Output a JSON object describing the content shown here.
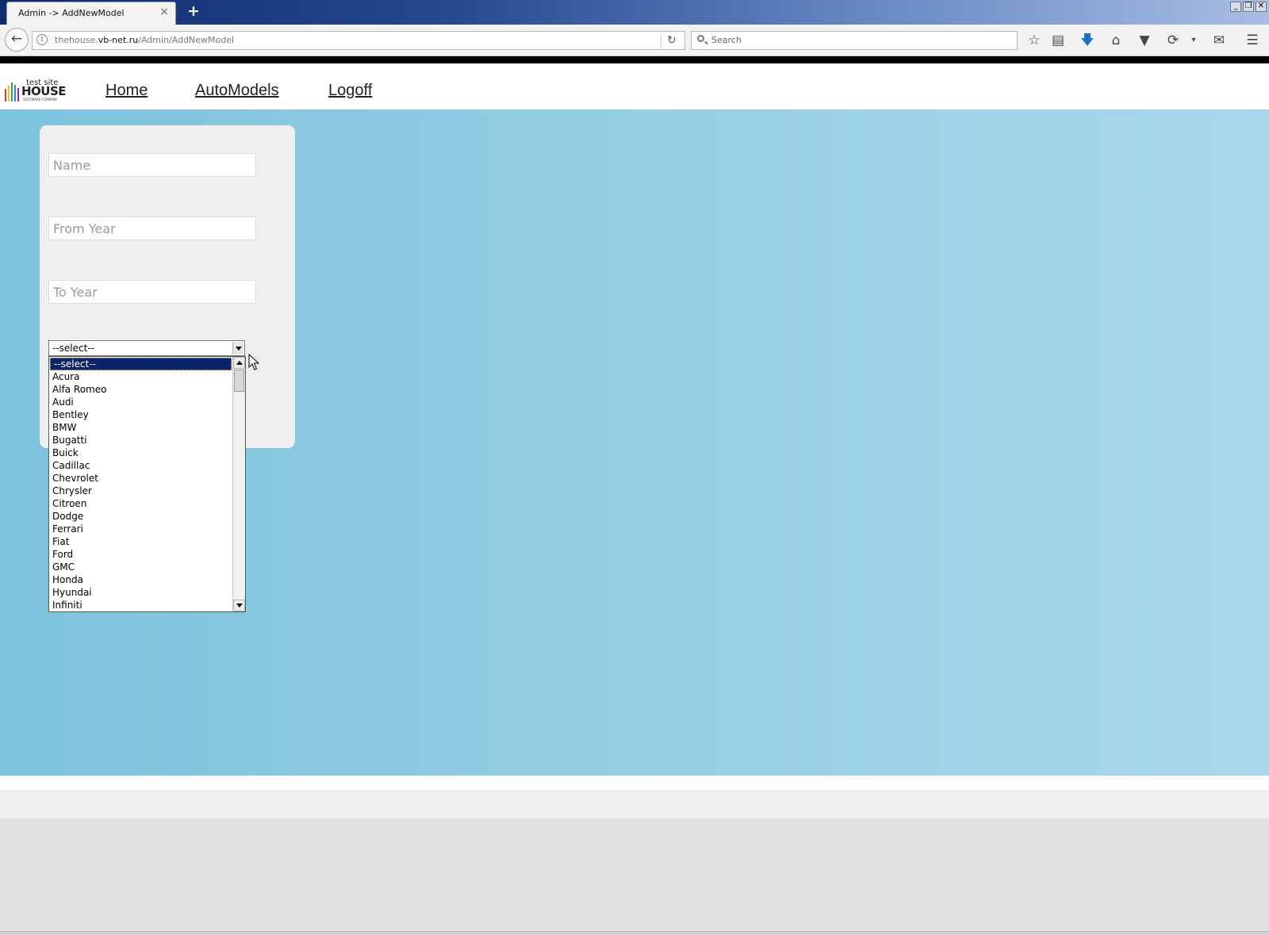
{
  "browser": {
    "tab_title": "Admin -> AddNewModel",
    "tab_close": "×",
    "new_tab": "+",
    "url_domain_prefix": "thehouse.",
    "url_domain_main": "vb-net.ru",
    "url_path": "/Admin/AddNewModel",
    "search_placeholder": "Search",
    "window_buttons": [
      "_",
      "❐",
      "✕"
    ]
  },
  "site": {
    "logo": {
      "small_text": "test site",
      "big_text": "HOUSE",
      "tagline": "SOFTWARE COMPANY",
      "bar_colors": [
        "#e53935",
        "#fbc02d",
        "#43a047",
        "#1e88e5",
        "#8e24aa",
        "#f4511e"
      ]
    },
    "nav": [
      {
        "label": "Home"
      },
      {
        "label": "AutoModels"
      },
      {
        "label": "Logoff"
      }
    ]
  },
  "form": {
    "name_placeholder": "Name",
    "from_year_placeholder": "From Year",
    "to_year_placeholder": "To Year",
    "select_value": "--select--",
    "options": [
      "--select--",
      "Acura",
      "Alfa Romeo",
      "Audi",
      "Bentley",
      "BMW",
      "Bugatti",
      "Buick",
      "Cadillac",
      "Chevrolet",
      "Chrysler",
      "Citroen",
      "Dodge",
      "Ferrari",
      "Fiat",
      "Ford",
      "GMC",
      "Honda",
      "Hyundai",
      "Infiniti"
    ],
    "selected_index": 0
  },
  "colors": {
    "selection": "#0a246a",
    "accent_blue": "#8fcbe1"
  }
}
